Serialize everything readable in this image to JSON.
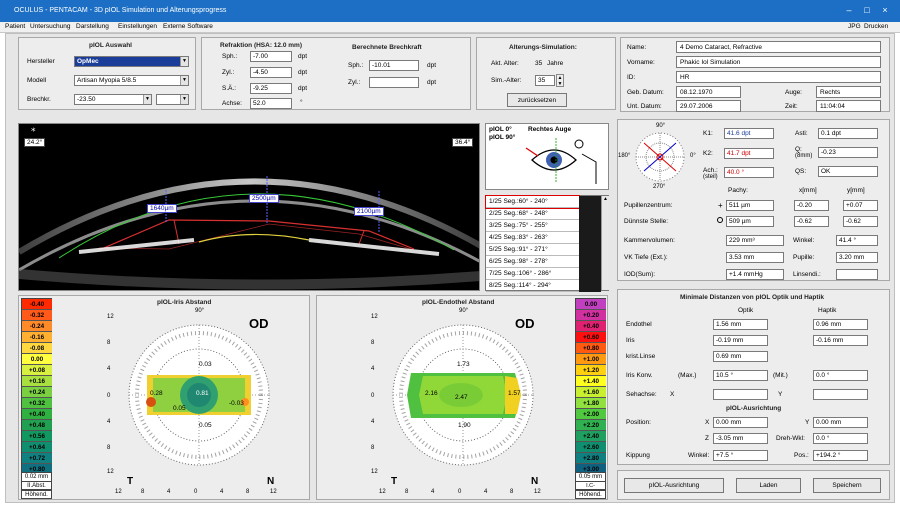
{
  "window": {
    "title": "OCULUS - PENTACAM - 3D pIOL Simulation und Alterungsprogress",
    "min": "–",
    "max": "□",
    "close": "×"
  },
  "menu": {
    "items": [
      "Patient",
      "Untersuchung",
      "Darstellung",
      "Einstellungen",
      "Externe Software"
    ],
    "right": [
      "JPG",
      "Drucken"
    ]
  },
  "piol": {
    "title": "pIOL Auswahl",
    "hersteller_label": "Hersteller",
    "hersteller": "OpMec",
    "modell_label": "Modell",
    "modell": "Artisan Myopia 5/8.5",
    "brechkr_label": "Brechkr.",
    "brechkr": "-23.50",
    "brechkr2": ""
  },
  "refraktion": {
    "title": "Refraktion (HSA: 12.0 mm)",
    "sph_label": "Sph.:",
    "sph": "-7.00",
    "zyl_label": "Zyl.:",
    "zyl": "-4.50",
    "sa_label": "S.Ä.:",
    "sa": "-9.25",
    "achse_label": "Achse:",
    "achse": "52.0",
    "unit": "dpt",
    "deg": "°"
  },
  "berechnete": {
    "title": "Berechnete Brechkraft",
    "sph_label": "Sph.:",
    "sph": "-10.01",
    "zyl_label": "Zyl.:",
    "zyl": "",
    "unit": "dpt"
  },
  "alterung": {
    "title": "Alterungs-Simulation:",
    "akt_label": "Akt. Alter:",
    "akt": "35",
    "akt_unit": "Jahre",
    "sim_label": "Sim.-Alter:",
    "sim": "35",
    "reset": "zurücksetzen"
  },
  "patient": {
    "name_label": "Name:",
    "name": "4 Demo Cataract, Refractive",
    "vorname_label": "Vorname:",
    "vorname": "Phakic Iol Simulation",
    "id_label": "ID:",
    "id": "HR",
    "geb_label": "Geb. Datum:",
    "geb": "08.12.1970",
    "auge_label": "Auge:",
    "auge": "Rechts",
    "unt_label": "Unt. Datum:",
    "unt": "29.07.2006",
    "zeit_label": "Zeit:",
    "zeit": "11:04:04"
  },
  "scan": {
    "angle_left": "24.2°",
    "angle_right": "36.4°",
    "dist_left": "1640µm",
    "dist_center": "2500µm",
    "dist_right": "2100µm",
    "piol_labels": [
      "pIOL 0°",
      "pIOL 90°"
    ],
    "eye_label": "Rechtes Auge",
    "list": [
      "1/25  Seg.:60° - 240°",
      "2/25  Seg.:68° - 248°",
      "3/25  Seg.:75° - 255°",
      "4/25  Seg.:83° - 263°",
      "5/25  Seg.:91° - 271°",
      "6/25  Seg.:98° - 278°",
      "7/25  Seg.:106° - 286°",
      "8/25  Seg.:114° - 294°"
    ]
  },
  "kerato": {
    "k1_label": "K1:",
    "k1": "41.6 dpt",
    "k2_label": "K2:",
    "k2": "41.7 dpt",
    "ach_label": "Ach.:",
    "ach_sub": "(steil)",
    "ach": "40.0 °",
    "asti_label": "Asti:",
    "asti": "0.1 dpt",
    "q_label": "Q:",
    "q_sub": "(8mm)",
    "q": "-0.23",
    "qs_label": "QS:",
    "qs": "OK",
    "compass_top": "90°",
    "compass_bottom": "270°",
    "compass_left": "180°",
    "compass_right": "0°"
  },
  "pupil": {
    "pachy_label": "Pachy:",
    "x_label": "x[mm]",
    "y_label": "y[mm]",
    "pz_label": "Pupillenzentrum:",
    "pz_pachy": "511 µm",
    "pz_x": "-0.20",
    "pz_y": "+0.07",
    "ds_label": "Dünnste Stelle:",
    "ds_pachy": "509 µm",
    "ds_x": "-0.62",
    "ds_y": "-0.62"
  },
  "kammer": {
    "kv_label": "Kammervolumen:",
    "kv": "229 mm³",
    "winkel_label": "Winkel:",
    "winkel": "41.4 °",
    "vk_label": "VK Tiefe (Ext.):",
    "vk": "3.53 mm",
    "pupille_label": "Pupille:",
    "pupille": "3.20 mm",
    "iod_label": "IOD(Sum):",
    "iod": "+1.4 mmHg",
    "linsendi_label": "Linsendi.:",
    "linsendi": ""
  },
  "irismap": {
    "title": "pIOL-Iris Abstand",
    "od": "OD",
    "scale": [
      "-0.40",
      "-0.32",
      "-0.24",
      "-0.16",
      "-0.08",
      "0.00",
      "+0.08",
      "+0.16",
      "+0.24",
      "+0.32",
      "+0.40",
      "+0.48",
      "+0.56",
      "+0.64",
      "+0.72",
      "+0.80"
    ],
    "scale_colors": [
      "#ff2a00",
      "#ff5a1a",
      "#ff8a2a",
      "#ffb030",
      "#ffd840",
      "#ffff40",
      "#d8f040",
      "#a8e040",
      "#7ad040",
      "#50c040",
      "#30b040",
      "#20a050",
      "#109860",
      "#108f70",
      "#108080",
      "#107080"
    ],
    "unit": "0.02 mm",
    "abst": "II.Abst.",
    "hoehe": "Höhend.",
    "values": [
      "0.03",
      "0.81",
      "0.28",
      "-0.03",
      "0.05",
      "0.05"
    ],
    "t": "T",
    "n": "N",
    "top": "90°",
    "axis": [
      "12",
      "8",
      "4",
      "0",
      "4",
      "8",
      "12"
    ]
  },
  "endomap": {
    "title": "pIOL-Endothel Abstand",
    "od": "OD",
    "scale": [
      "0.00",
      "+0.20",
      "+0.40",
      "+0.60",
      "+0.80",
      "+1.00",
      "+1.20",
      "+1.40",
      "+1.60",
      "+1.80",
      "+2.00",
      "+2.20",
      "+2.40",
      "+2.60",
      "+2.80",
      "+3.00"
    ],
    "scale_colors": [
      "#c040c0",
      "#d030a0",
      "#e02070",
      "#ff1010",
      "#ff5a10",
      "#ff9a10",
      "#ffd010",
      "#ffff20",
      "#c8f030",
      "#90e040",
      "#50c840",
      "#30b050",
      "#20a060",
      "#108f70",
      "#107f80",
      "#106080"
    ],
    "unit": "0.05 mm",
    "abst": "I.C-Abstand",
    "hoehe": "Höhend.",
    "values": [
      "1.73",
      "2.16",
      "2.47",
      "1.57",
      "1.90"
    ],
    "t": "T",
    "n": "N",
    "top": "90°",
    "axis": [
      "12",
      "8",
      "4",
      "0",
      "4",
      "8",
      "12"
    ]
  },
  "distanzen": {
    "title": "Minimale Distanzen von pIOL Optik und Haptik",
    "optik_label": "Optik",
    "haptik_label": "Haptik",
    "endothel_label": "Endothel",
    "endothel_optik": "1.56 mm",
    "endothel_haptik": "0.96 mm",
    "iris_label": "Iris",
    "iris_optik": "-0.19 mm",
    "iris_haptik": "-0.16 mm",
    "krist_label": "krist.Linse",
    "krist_optik": "0.69 mm",
    "konv_label": "Iris Konv.",
    "konv_max": "(Max.)",
    "konv": "10.5 °",
    "konv_mit": "(Mit.)",
    "konv2": "0.0 °",
    "sehachse_label": "Sehachse:",
    "x_label": "X",
    "y_label": "Y",
    "sehachse_x": "",
    "sehachse_y": "",
    "ausr_title": "pIOL-Ausrichtung",
    "pos_label": "Position:",
    "pos_x": "0.00 mm",
    "pos_y": "0.00 mm",
    "z_label": "Z",
    "pos_z": "-3.05 mm",
    "drehwkl_label": "Dreh-Wkl:",
    "drehwkl": "0.0 °",
    "kipp_label": "Kippung",
    "winkel_label": "Winkel:",
    "kipp_winkel": "+7.5 °",
    "pos2_label": "Pos.:",
    "kipp_pos": "+194.2 °"
  },
  "buttons": {
    "ausrichtung": "pIOL-Ausrichtung",
    "laden": "Laden",
    "speichern": "Speichern"
  }
}
